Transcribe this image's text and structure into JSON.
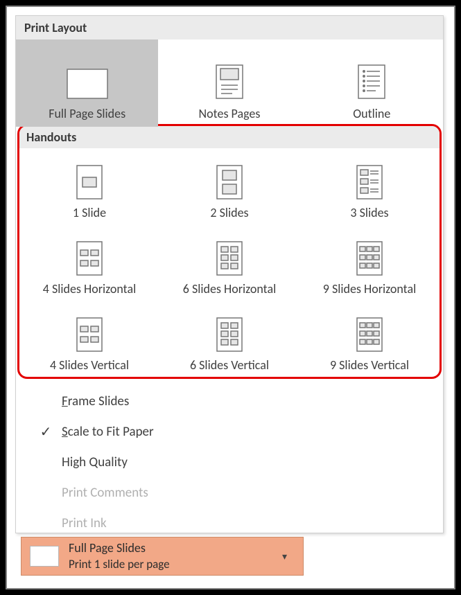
{
  "sections": {
    "print_layout": "Print Layout",
    "handouts": "Handouts"
  },
  "layout_options": {
    "full_page": "Full Page Slides",
    "notes": "Notes Pages",
    "outline": "Outline"
  },
  "handouts": {
    "s1": "1 Slide",
    "s2": "2 Slides",
    "s3": "3 Slides",
    "h4": "4 Slides Horizontal",
    "h6": "6 Slides Horizontal",
    "h9": "9 Slides Horizontal",
    "v4": "4 Slides Vertical",
    "v6": "6 Slides Vertical",
    "v9": "9 Slides Vertical"
  },
  "extra": {
    "frame": "Frame Slides",
    "scale": "Scale to Fit Paper",
    "hq": "High Quality",
    "comments": "Print Comments",
    "ink": "Print Ink"
  },
  "dropdown": {
    "title": "Full Page Slides",
    "subtitle": "Print 1 slide per page"
  }
}
